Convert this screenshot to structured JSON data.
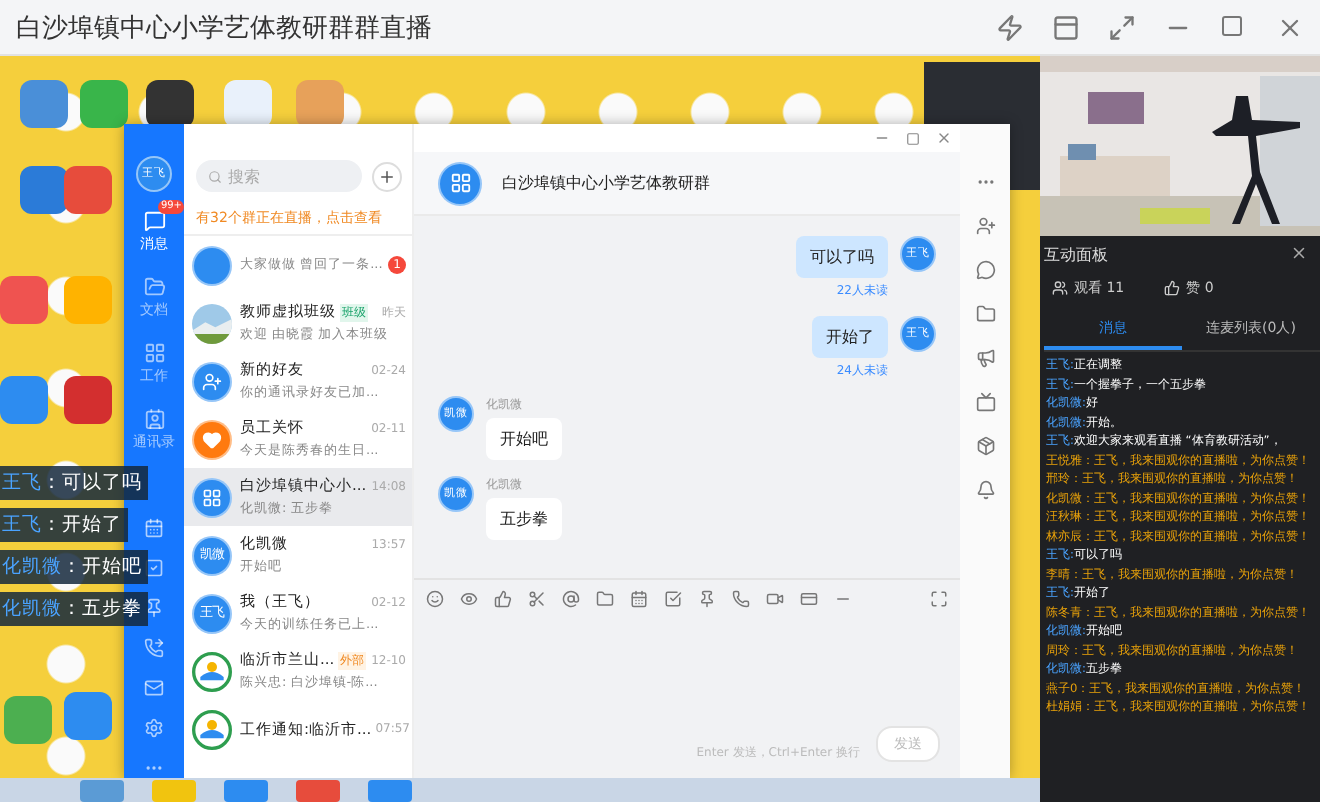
{
  "window": {
    "title": "白沙埠镇中心小学艺体教研群群直播"
  },
  "overlay_comments": [
    {
      "name": "王飞",
      "text": "：可以了吗"
    },
    {
      "name": "王飞",
      "text": "：开始了"
    },
    {
      "name": "化凯微",
      "text": "：开始吧"
    },
    {
      "name": "化凯微",
      "text": "：五步拳"
    }
  ],
  "sidebar": {
    "avatar": "王飞",
    "items": [
      {
        "label": "消息",
        "selected": true,
        "badge": "99+"
      },
      {
        "label": "文档",
        "selected": false
      },
      {
        "label": "工作",
        "selected": false
      },
      {
        "label": "通讯录",
        "selected": false
      }
    ]
  },
  "search": {
    "placeholder": "搜索"
  },
  "notice": "有32个群正在直播，点击查看",
  "chats": [
    {
      "kind": "blank",
      "preview": "大家做做 曾回了一条...",
      "badge": "1",
      "selected": false
    },
    {
      "kind": "picture",
      "name": "教师虚拟班级",
      "tag": "班级",
      "time": "昨天",
      "preview": "欢迎 由晓霞 加入本班级",
      "selected": false
    },
    {
      "kind": "person-add",
      "name": "新的好友",
      "time": "02-24",
      "preview": "你的通讯录好友已加...",
      "selected": false
    },
    {
      "kind": "heart",
      "name": "员工关怀",
      "time": "02-11",
      "preview": "今天是陈秀春的生日...",
      "selected": false
    },
    {
      "kind": "grid",
      "name": "白沙埠镇中心小...",
      "time": "14:08",
      "preview": "化凯微: 五步拳",
      "selected": true
    },
    {
      "kind": "text",
      "label": "凯微",
      "name": "化凯微",
      "time": "13:57",
      "preview": "开始吧",
      "selected": false
    },
    {
      "kind": "text",
      "label": "王飞",
      "name": "我（王飞）",
      "time": "02-12",
      "preview": "今天的训练任务已上...",
      "selected": false
    },
    {
      "kind": "logo",
      "name": "临沂市兰山...",
      "tag": "外部",
      "time": "12-10",
      "preview": "陈兴忠: 白沙埠镇-陈...",
      "selected": false
    },
    {
      "kind": "logo",
      "name": "工作通知:临沂市...",
      "time": "07:57",
      "selected": false
    }
  ],
  "chat": {
    "title": "白沙埠镇中心小学艺体教研群",
    "messages": [
      {
        "kind": "sent",
        "avatar": "王飞",
        "text": "可以了吗",
        "status": "22人未读"
      },
      {
        "kind": "sent",
        "avatar": "王飞",
        "text": "开始了",
        "status": "24人未读"
      },
      {
        "kind": "received",
        "avatar": "凯微",
        "sender": "化凯微",
        "text": "开始吧"
      },
      {
        "kind": "received",
        "avatar": "凯微",
        "sender": "化凯微",
        "text": "五步拳"
      }
    ],
    "input": {
      "placeholder": "Enter 发送，Ctrl+Enter 换行"
    },
    "send": "发送"
  },
  "panel": {
    "title": "互动面板",
    "viewers": "观看 11",
    "likes": "赞 0",
    "tabs": [
      {
        "label": "消息",
        "selected": true
      },
      {
        "label": "连麦列表(0人)",
        "selected": false
      }
    ],
    "comments": [
      {
        "kind": "host",
        "name": "王飞:",
        "text": "正在调整"
      },
      {
        "kind": "host",
        "name": "王飞:",
        "text": "一个握拳子，一个五步拳"
      },
      {
        "kind": "host",
        "name": "化凯微:",
        "text": "好"
      },
      {
        "kind": "host",
        "name": "化凯微:",
        "text": "开始。"
      },
      {
        "kind": "host",
        "name": "王飞:",
        "text": "欢迎大家来观看直播 “体育教研活动”，"
      },
      {
        "kind": "like",
        "name": "王悦雅：",
        "text": "王飞，我来围观你的直播啦，为你点赞！"
      },
      {
        "kind": "like",
        "name": "邢玲：",
        "text": "王飞，我来围观你的直播啦，为你点赞！"
      },
      {
        "kind": "like",
        "name": "化凯微：",
        "text": "王飞，我来围观你的直播啦，为你点赞！"
      },
      {
        "kind": "like",
        "name": "汪秋琳：",
        "text": "王飞，我来围观你的直播啦，为你点赞！"
      },
      {
        "kind": "like",
        "name": "林亦辰：",
        "text": "王飞，我来围观你的直播啦，为你点赞！"
      },
      {
        "kind": "host",
        "name": "王飞:",
        "text": "可以了吗"
      },
      {
        "kind": "like",
        "name": "李晴：",
        "text": "王飞，我来围观你的直播啦，为你点赞！"
      },
      {
        "kind": "host",
        "name": "王飞:",
        "text": "开始了"
      },
      {
        "kind": "like",
        "name": "陈冬青：",
        "text": "王飞，我来围观你的直播啦，为你点赞！"
      },
      {
        "kind": "host",
        "name": "化凯微:",
        "text": "开始吧"
      },
      {
        "kind": "like",
        "name": "周玲：",
        "text": "王飞，我来围观你的直播啦，为你点赞！"
      },
      {
        "kind": "host",
        "name": "化凯微:",
        "text": "五步拳"
      },
      {
        "kind": "like",
        "name": "燕子0：",
        "text": "王飞，我来围观你的直播啦，为你点赞！"
      },
      {
        "kind": "like",
        "name": "杜娟娟：",
        "text": "王飞，我来围观你的直播啦，为你点赞！"
      }
    ]
  }
}
